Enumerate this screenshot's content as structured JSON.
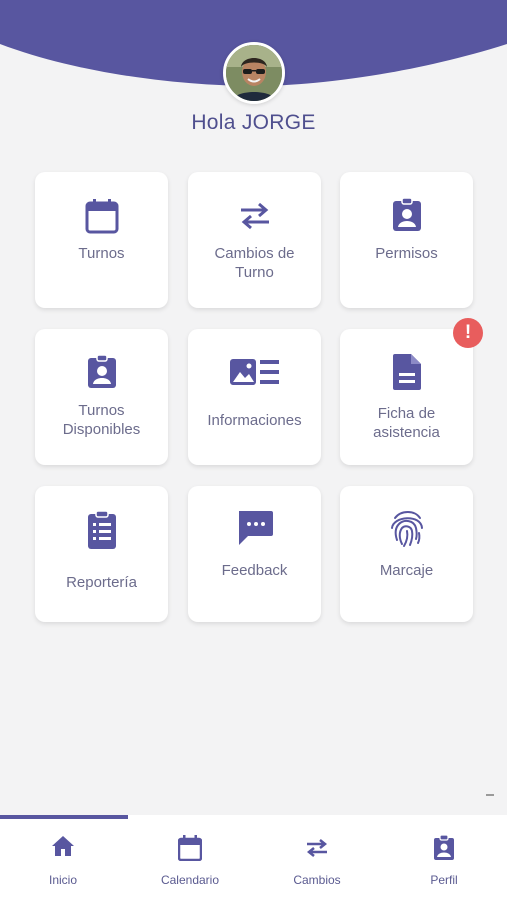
{
  "header": {
    "greeting": "Hola JORGE",
    "accent_color": "#5856a0"
  },
  "tiles": [
    {
      "label": "Turnos",
      "icon": "calendar-icon"
    },
    {
      "label": "Cambios de Turno",
      "icon": "swap-arrows-icon"
    },
    {
      "label": "Permisos",
      "icon": "badge-icon"
    },
    {
      "label": "Turnos Disponibles",
      "icon": "badge-icon"
    },
    {
      "label": "Informaciones",
      "icon": "news-icon"
    },
    {
      "label": "Ficha de asistencia",
      "icon": "document-icon",
      "alert": "!"
    },
    {
      "label": "Reportería",
      "icon": "clipboard-list-icon"
    },
    {
      "label": "Feedback",
      "icon": "chat-bubble-icon"
    },
    {
      "label": "Marcaje",
      "icon": "fingerprint-icon"
    }
  ],
  "alert_color": "#e85d5d",
  "bottom_nav": [
    {
      "label": "Inicio",
      "icon": "home-icon",
      "active": true
    },
    {
      "label": "Calendario",
      "icon": "calendar-icon"
    },
    {
      "label": "Cambios",
      "icon": "swap-arrows-icon"
    },
    {
      "label": "Perfil",
      "icon": "badge-icon"
    }
  ]
}
